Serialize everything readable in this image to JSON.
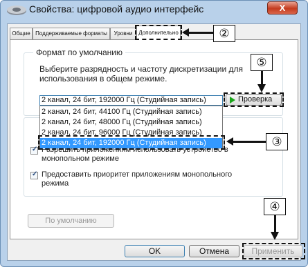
{
  "window": {
    "title": "Свойства: цифровой аудио интерфейс",
    "close_label": "X"
  },
  "tabs": [
    {
      "label": "Общие"
    },
    {
      "label": "Поддерживаемые форматы"
    },
    {
      "label": "Уровни"
    },
    {
      "label": "Дополнительно",
      "active": true
    }
  ],
  "default_format": {
    "legend": "Формат по умолчанию",
    "description": "Выберите разрядность и частоту дискретизации для использования в общем режиме.",
    "selected_value": "2 канал, 24 бит, 192000 Гц (Студийная запись)",
    "options": [
      "2 канал, 24 бит, 44100 Гц (Студийная запись)",
      "2 канал, 24 бит, 48000 Гц (Студийная запись)",
      "2 канал, 24 бит, 96000 Гц (Студийная запись)",
      "2 канал, 24 бит, 192000 Гц (Студийная запись)"
    ],
    "highlighted_option_index": 3,
    "test_button": "Проверка",
    "test_icon": "play-icon"
  },
  "exclusive_mode": {
    "items": [
      {
        "label": "Разрешить приложениям использовать устройство в монопольном режиме",
        "checked": true
      },
      {
        "label": "Предоставить приоритет приложениям монопольного режима",
        "checked": true
      }
    ]
  },
  "restore_defaults_button": "По умолчанию",
  "buttons": {
    "ok": "OK",
    "cancel": "Отмена",
    "apply": "Применить"
  },
  "callouts": {
    "tab": "②",
    "select_option": "③",
    "apply": "④",
    "test": "⑤"
  },
  "colors": {
    "title_bar": "#b9d1ea",
    "close_button": "#c43b1f",
    "selection": "#3399ff",
    "play_icon": "#1aa51a"
  }
}
